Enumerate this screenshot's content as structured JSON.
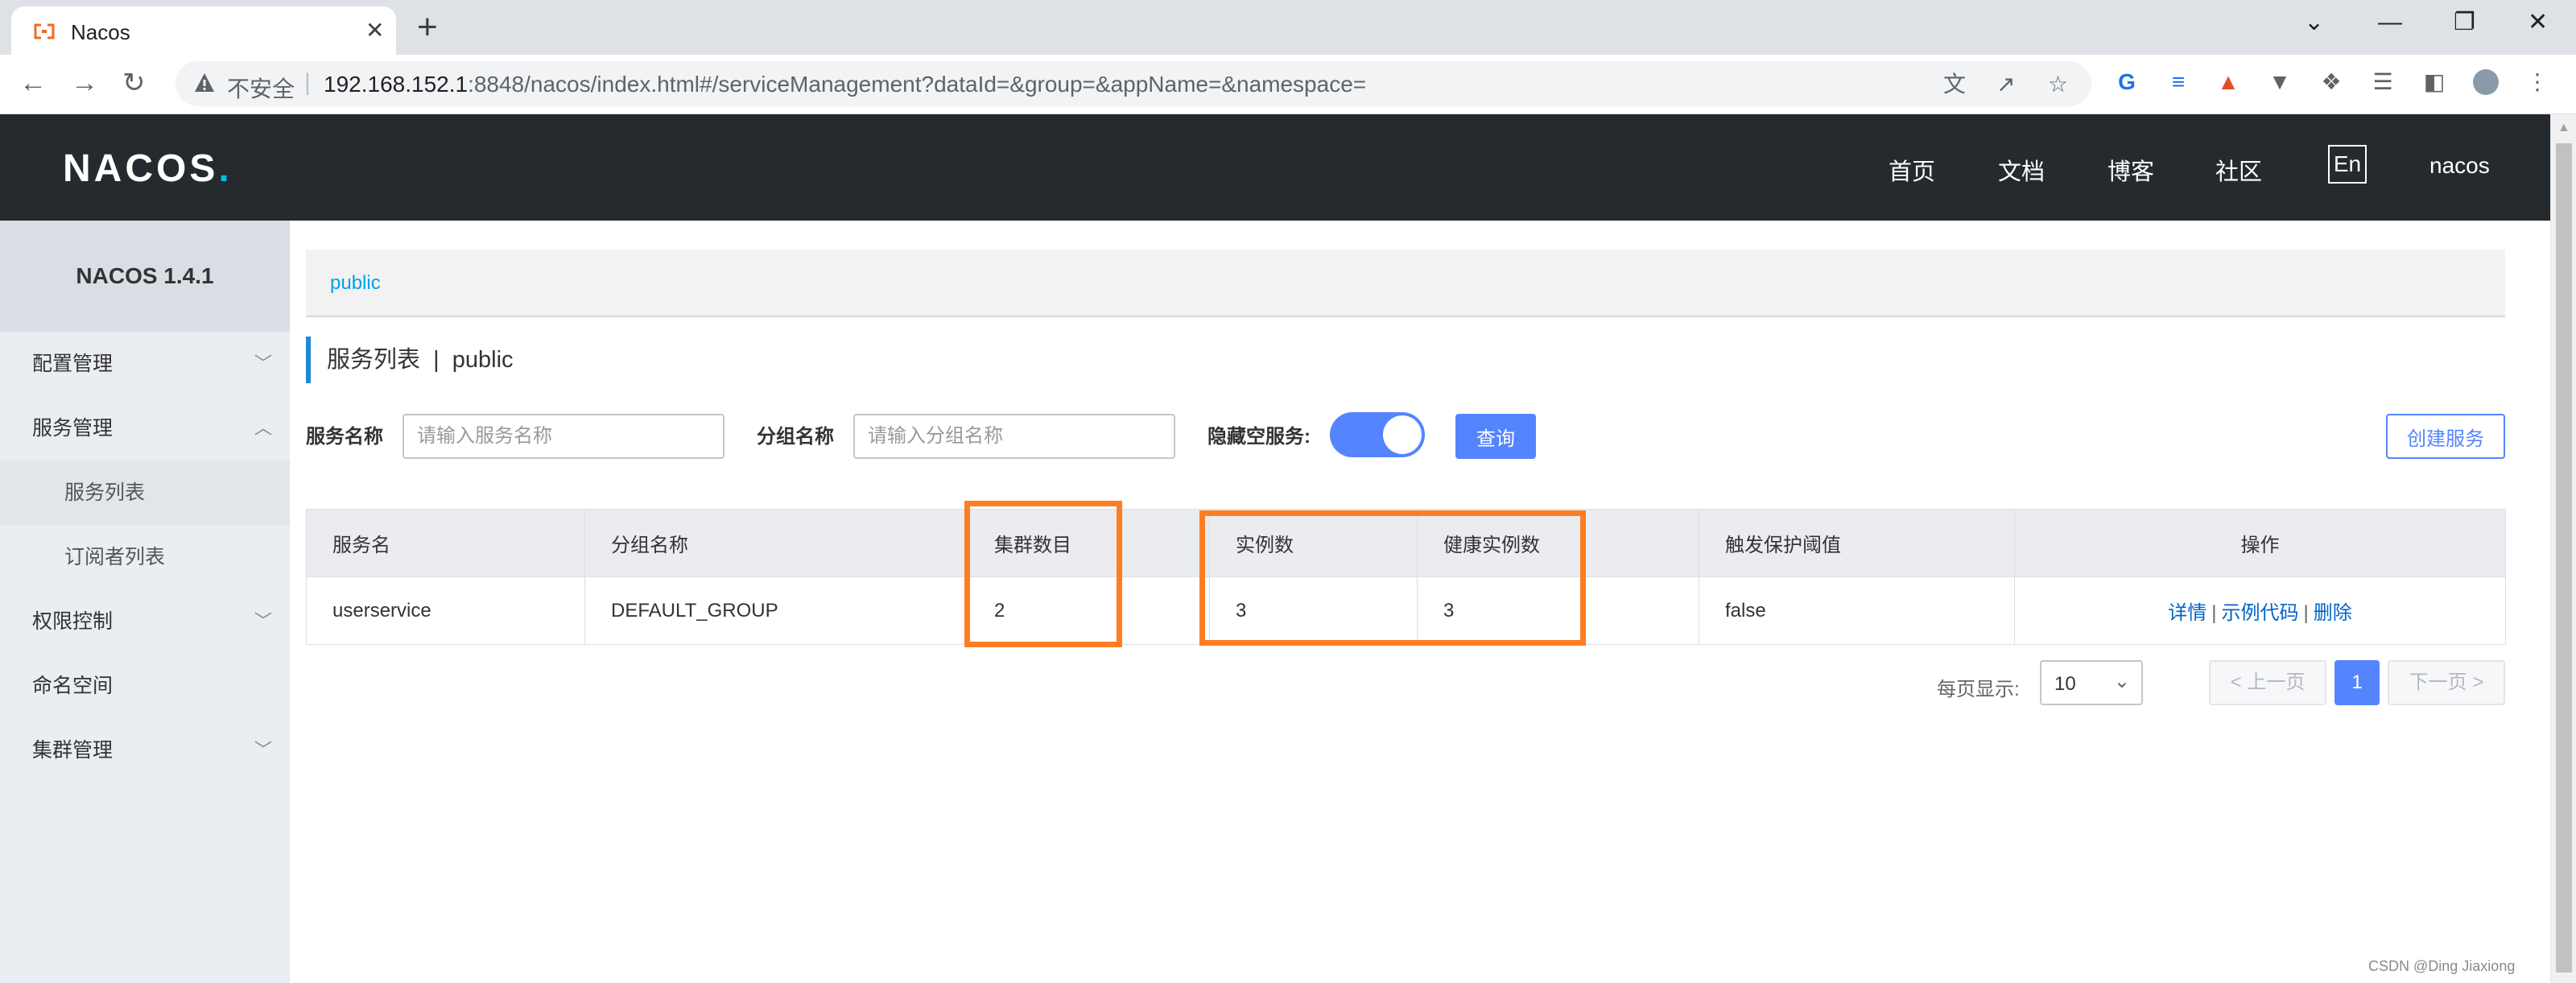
{
  "browser": {
    "tab_title": "Nacos",
    "tab_close": "✕",
    "new_tab": "+",
    "window_controls": [
      "⌄",
      "—",
      "❐",
      "✕"
    ],
    "insecure_label": "不安全",
    "url_host": "192.168.152.1",
    "url_rest": ":8848/nacos/index.html#/serviceManagement?dataId=&group=&appName=&namespace=",
    "nav_icons": [
      "arrow-left",
      "arrow-right",
      "reload"
    ],
    "extension_icons": [
      "translate-icon",
      "share-icon",
      "bookmark-star-icon",
      "google-translate-icon",
      "extension-layers-icon",
      "extension-red-icon",
      "vue-devtools-icon",
      "puzzle-icon",
      "reading-list-icon",
      "side-panel-icon",
      "profile-avatar",
      "menu-icon"
    ]
  },
  "header": {
    "logo": "NACOS.",
    "nav": [
      "首页",
      "文档",
      "博客",
      "社区"
    ],
    "lang_button": "En",
    "user": "nacos"
  },
  "sidebar": {
    "title": "NACOS 1.4.1",
    "items": [
      {
        "label": "配置管理",
        "arrow": "﹀"
      },
      {
        "label": "服务管理",
        "arrow": "︿"
      },
      {
        "label": "服务列表"
      },
      {
        "label": "订阅者列表"
      },
      {
        "label": "权限控制",
        "arrow": "﹀"
      },
      {
        "label": "命名空间"
      },
      {
        "label": "集群管理",
        "arrow": "﹀"
      }
    ]
  },
  "main": {
    "namespace_tab": "public",
    "heading": "服务列表  |  public",
    "filters": {
      "service_name_label": "服务名称",
      "service_name_placeholder": "请输入服务名称",
      "group_name_label": "分组名称",
      "group_name_placeholder": "请输入分组名称",
      "hide_empty_label": "隐藏空服务:",
      "hide_empty_on": true,
      "query_button": "查询",
      "create_button": "创建服务"
    },
    "table": {
      "columns": [
        "服务名",
        "分组名称",
        "集群数目",
        "实例数",
        "健康实例数",
        "触发保护阈值",
        "操作"
      ],
      "rows": [
        {
          "service": "userservice",
          "group": "DEFAULT_GROUP",
          "clusters": "2",
          "instances": "3",
          "healthy": "3",
          "threshold": "false",
          "actions": [
            "详情",
            "示例代码",
            "删除"
          ]
        }
      ],
      "action_separator": "|"
    },
    "pagination": {
      "per_page_label": "每页显示:",
      "per_page_value": "10",
      "prev": "< 上一页",
      "current": "1",
      "next": "下一页 >"
    }
  },
  "watermark": "CSDN @Ding Jiaxiong",
  "colors": {
    "header_bg": "#252a2f",
    "accent": "#5584ff",
    "highlight": "#ff7d22",
    "link": "#0064c8"
  }
}
